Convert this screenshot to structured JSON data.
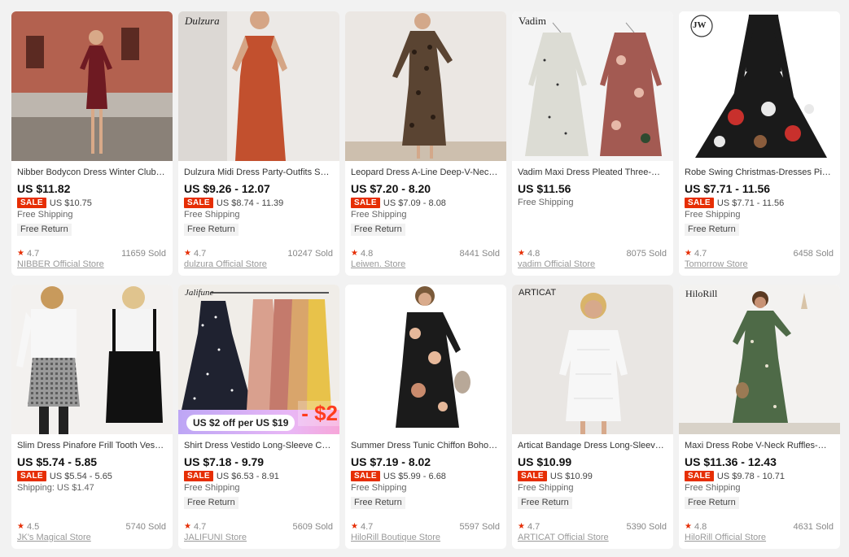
{
  "products": [
    {
      "brand": "",
      "title": "Nibber Bodycon Dress Winter Club Party",
      "price": "US $11.82",
      "sale_label": "SALE",
      "sale_price": "US $10.75",
      "shipping": "Free Shipping",
      "free_return": "Free Return",
      "rating": "4.7",
      "sold": "11659 Sold",
      "store": "NIBBER Official Store",
      "colors": {
        "bg": "#b3614f",
        "dress": "#6e1a22",
        "skin": "#d8a988"
      }
    },
    {
      "brand": "Dulzura",
      "title": "Dulzura Midi Dress Party-Outfits Satin Bodycon",
      "price": "US $9.26 - 12.07",
      "sale_label": "SALE",
      "sale_price": "US $8.74 - 11.39",
      "shipping": "Free Shipping",
      "free_return": "Free Return",
      "rating": "4.7",
      "sold": "10247 Sold",
      "store": "dulzura Official Store",
      "colors": {
        "bg": "#ece9e6",
        "dress": "#c2502e",
        "skin": "#d5a585"
      }
    },
    {
      "brand": "",
      "title": "Leopard Dress A-Line Deep-V-Neck Casual Women",
      "price": "US $7.20 - 8.20",
      "sale_label": "SALE",
      "sale_price": "US $7.09 - 8.08",
      "shipping": "Free Shipping",
      "free_return": "Free Return",
      "rating": "4.8",
      "sold": "8441 Sold",
      "store": "Leiwen. Store",
      "colors": {
        "bg": "#ebe7e3",
        "dress": "#5a4432",
        "skin": "#d3a88a"
      }
    },
    {
      "brand": "Vadim",
      "title": "Vadim Maxi Dress Pleated Three-Quarter Sleeve",
      "price": "US $11.56",
      "sale_label": "",
      "sale_price": "",
      "shipping": "Free Shipping",
      "free_return": "",
      "rating": "4.8",
      "sold": "8075 Sold",
      "store": "vadim Official Store",
      "colors": {
        "bg": "#f4f4f4",
        "dress": "#dcdcd4",
        "skin": "#a35a52"
      }
    },
    {
      "brand": "JW",
      "title": "Robe Swing Christmas-Dresses Pin Up Vintage",
      "price": "US $7.71 - 11.56",
      "sale_label": "SALE",
      "sale_price": "US $7.71 - 11.56",
      "shipping": "Free Shipping",
      "free_return": "Free Return",
      "rating": "4.7",
      "sold": "6458 Sold",
      "store": "Tomorrow Store",
      "colors": {
        "bg": "#ffffff",
        "dress": "#1a1a1a",
        "skin": "#c8302c"
      }
    },
    {
      "brand": "",
      "title": "Slim Dress Pinafore Frill Tooth Vest Skirt",
      "price": "US $5.74 - 5.85",
      "sale_label": "SALE",
      "sale_price": "US $5.54 - 5.65",
      "shipping": "Shipping: US $1.47",
      "free_return": "",
      "rating": "4.5",
      "sold": "5740 Sold",
      "store": "JK's Magical Store",
      "colors": {
        "bg": "#f3f1ef",
        "dress": "#6d6d6d",
        "skin": "#e0b99c"
      }
    },
    {
      "brand": "Jalifune",
      "title": "Shirt Dress Vestido Long-Sleeve Chiffon Polka",
      "price": "US $7.18 - 9.79",
      "sale_label": "SALE",
      "sale_price": "US $6.53 - 8.91",
      "shipping": "Free Shipping",
      "free_return": "Free Return",
      "rating": "4.7",
      "sold": "5609 Sold",
      "store": "JALIFUNI Store",
      "colors": {
        "bg": "#f0ede8",
        "dress": "#1f2230",
        "skin": "#d9a56b"
      }
    },
    {
      "brand": "",
      "title": "Summer Dress Tunic Chiffon Boho Floral Print",
      "price": "US $7.19 - 8.02",
      "sale_label": "SALE",
      "sale_price": "US $5.99 - 6.68",
      "shipping": "Free Shipping",
      "free_return": "Free Return",
      "rating": "4.7",
      "sold": "5597 Sold",
      "store": "HiloRill Boutique Store",
      "colors": {
        "bg": "#ffffff",
        "dress": "#1b1b1b",
        "skin": "#d9ab8c"
      }
    },
    {
      "brand": "ARTICAT",
      "title": "Articat Bandage Dress Long-Sleeve Off-Shoulder",
      "price": "US $10.99",
      "sale_label": "SALE",
      "sale_price": "US $10.99",
      "shipping": "Free Shipping",
      "free_return": "Free Return",
      "rating": "4.7",
      "sold": "5390 Sold",
      "store": "ARTICAT Official Store",
      "colors": {
        "bg": "#e9e6e3",
        "dress": "#f7f7f7",
        "skin": "#d7a98b"
      }
    },
    {
      "brand": "HiloRill",
      "title": "Maxi Dress Robe V-Neck Ruffles-Wrap Floral",
      "price": "US $11.36 - 12.43",
      "sale_label": "SALE",
      "sale_price": "US $9.78 - 10.71",
      "shipping": "Free Shipping",
      "free_return": "Free Return",
      "rating": "4.8",
      "sold": "4631 Sold",
      "store": "HiloRill Official Store",
      "colors": {
        "bg": "#f3f2f0",
        "dress": "#4e6a47",
        "skin": "#c89274"
      }
    }
  ],
  "promo": {
    "pill": "US $2 off per US $19",
    "amount": "- $2"
  }
}
